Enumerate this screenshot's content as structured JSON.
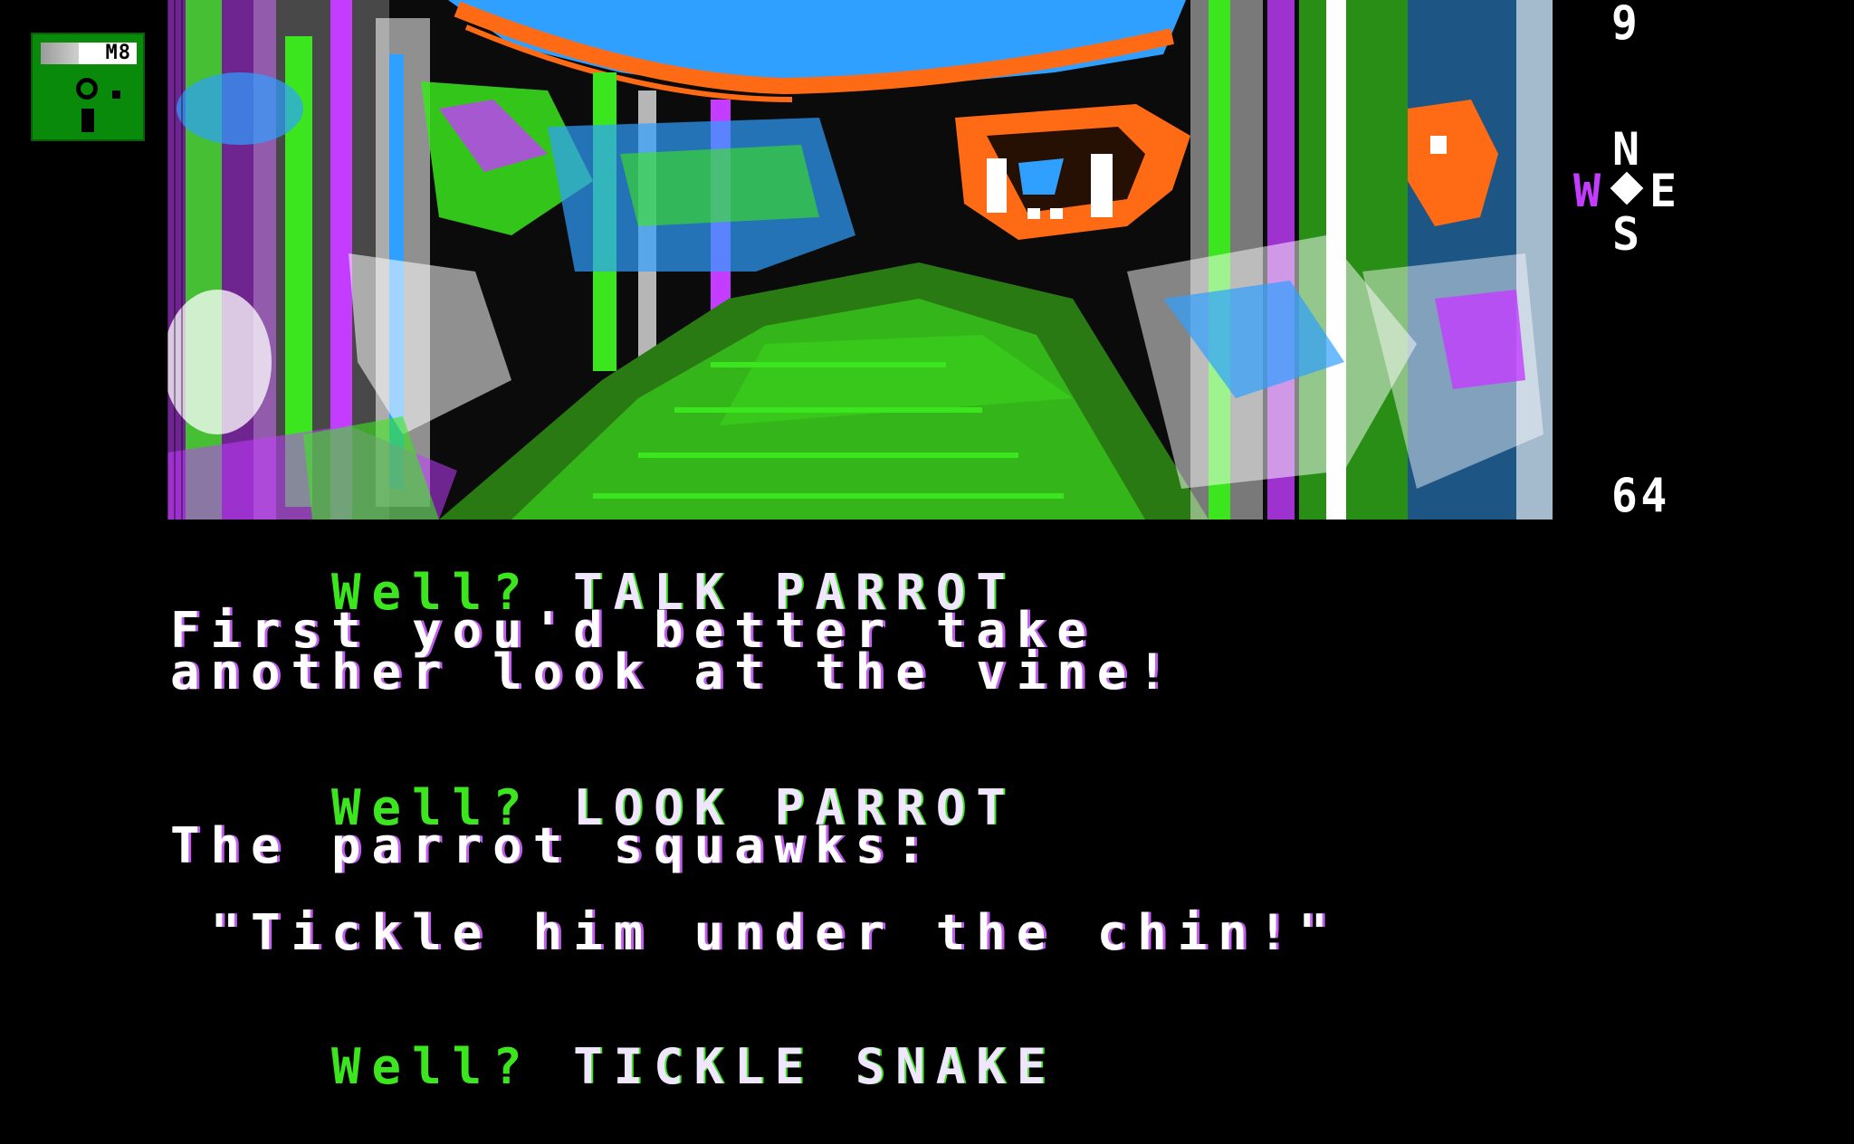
{
  "disk_indicator": {
    "label": "M8",
    "icon": "floppy-disk-icon"
  },
  "status": {
    "turns": "9",
    "score": "64"
  },
  "compass": {
    "north": "N",
    "south": "S",
    "east": "E",
    "west": "W",
    "icon": "compass-rose-icon"
  },
  "scene": {
    "description_icon": "jungle-clearing-illustration",
    "colors": {
      "sky": "#2fa0ff",
      "green": "#3ce61e",
      "violet": "#c33cff",
      "orange": "#ff6a14",
      "white": "#ffffff",
      "black": "#000000"
    }
  },
  "transcript": [
    {
      "type": "command",
      "prompt": "Well?",
      "text": "TALK PARROT"
    },
    {
      "type": "response",
      "text": "First you'd better take"
    },
    {
      "type": "response",
      "text": "another look at the vine!"
    },
    {
      "type": "command",
      "prompt": "Well?",
      "text": "LOOK PARROT"
    },
    {
      "type": "response",
      "text": "The parrot squawks:"
    },
    {
      "type": "response",
      "text": " \"Tickle him under the chin!\""
    },
    {
      "type": "command",
      "prompt": "Well?",
      "text": "TICKLE SNAKE"
    }
  ]
}
